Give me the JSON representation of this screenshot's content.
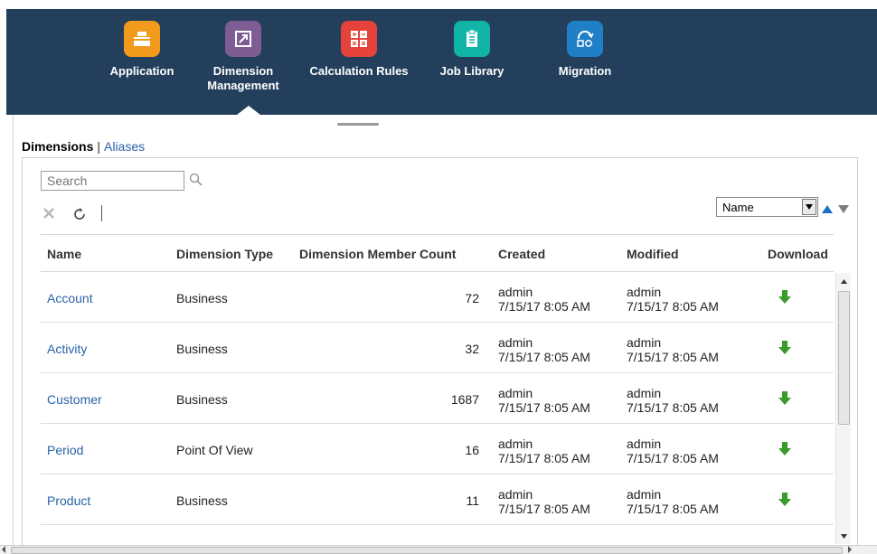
{
  "nav": {
    "items": [
      {
        "label": "Application",
        "icon": "application-icon",
        "color": "#f29a1c"
      },
      {
        "label": "Dimension Management",
        "icon": "dimension-management-icon",
        "color": "#7e5d94"
      },
      {
        "label": "Calculation Rules",
        "icon": "calculation-rules-icon",
        "color": "#e4423a"
      },
      {
        "label": "Job Library",
        "icon": "job-library-icon",
        "color": "#13b4a8"
      },
      {
        "label": "Migration",
        "icon": "migration-icon",
        "color": "#1f7fc7"
      }
    ],
    "selected": "Dimension Management",
    "background": "#233f5c"
  },
  "subtabs": {
    "active": "Dimensions",
    "separator": "|",
    "other": "Aliases"
  },
  "search": {
    "placeholder": "Search"
  },
  "sort": {
    "selected": "Name"
  },
  "table": {
    "columns": [
      "Name",
      "Dimension Type",
      "Dimension Member Count",
      "Created",
      "Modified",
      "Download"
    ],
    "rows": [
      {
        "name": "Account",
        "type": "Business",
        "count": "72",
        "created_by": "admin",
        "created_at": "7/15/17 8:05 AM",
        "modified_by": "admin",
        "modified_at": "7/15/17 8:05 AM"
      },
      {
        "name": "Activity",
        "type": "Business",
        "count": "32",
        "created_by": "admin",
        "created_at": "7/15/17 8:05 AM",
        "modified_by": "admin",
        "modified_at": "7/15/17 8:05 AM"
      },
      {
        "name": "Customer",
        "type": "Business",
        "count": "1687",
        "created_by": "admin",
        "created_at": "7/15/17 8:05 AM",
        "modified_by": "admin",
        "modified_at": "7/15/17 8:05 AM"
      },
      {
        "name": "Period",
        "type": "Point Of View",
        "count": "16",
        "created_by": "admin",
        "created_at": "7/15/17 8:05 AM",
        "modified_by": "admin",
        "modified_at": "7/15/17 8:05 AM"
      },
      {
        "name": "Product",
        "type": "Business",
        "count": "11",
        "created_by": "admin",
        "created_at": "7/15/17 8:05 AM",
        "modified_by": "admin",
        "modified_at": "7/15/17 8:05 AM"
      }
    ]
  },
  "colors": {
    "link": "#2a62a8",
    "download_arrow": "#3a9a2c",
    "sort_active": "#1f6fc4"
  }
}
